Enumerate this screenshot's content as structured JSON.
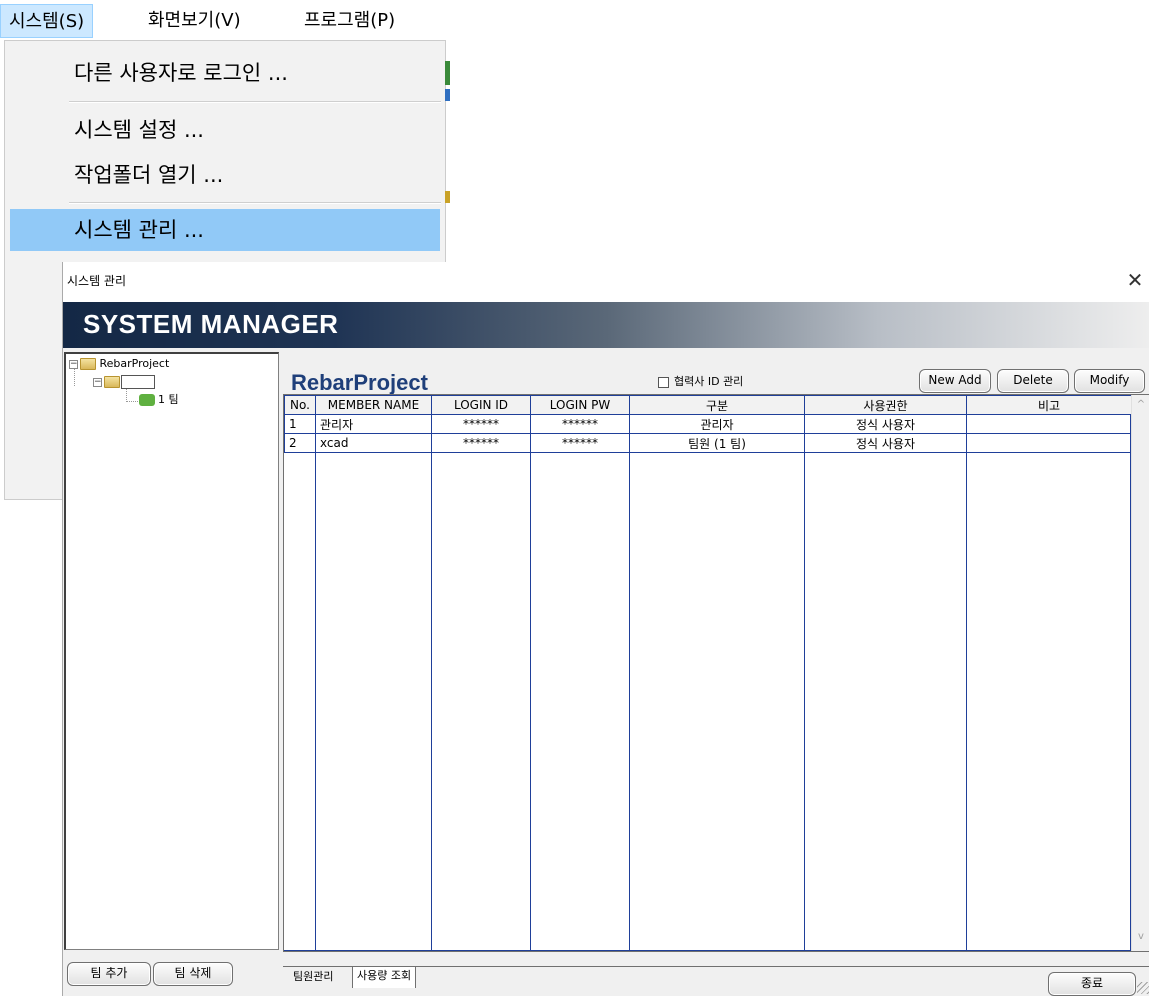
{
  "menubar": {
    "items": [
      {
        "label": "시스템(S)"
      },
      {
        "label": "화면보기(V)"
      },
      {
        "label": "프로그램(P)"
      }
    ]
  },
  "dropdown": {
    "items": [
      {
        "label": "다른 사용자로 로그인 ..."
      },
      {
        "label": "시스템 설정 ..."
      },
      {
        "label": "작업폴더 열기 ..."
      },
      {
        "label": "시스템 관리 ..."
      }
    ]
  },
  "dialog": {
    "title": "시스템 관리",
    "close_glyph": "✕",
    "banner": "SYSTEM MANAGER",
    "tree": {
      "root": "RebarProject",
      "team": "1 팀",
      "collapse_glyph": "−"
    },
    "left_buttons": {
      "add_team": "팀 추가",
      "delete_team": "팀 삭제"
    },
    "project_title": "RebarProject",
    "partner_checkbox": {
      "label": "협력사 ID 관리",
      "checked": false
    },
    "actions": {
      "new_add": "New Add",
      "delete": "Delete",
      "modify": "Modify"
    },
    "table": {
      "columns": [
        "No.",
        "MEMBER NAME",
        "LOGIN ID",
        "LOGIN PW",
        "구분",
        "사용권한",
        "비고"
      ],
      "rows": [
        [
          "1",
          "관리자",
          "******",
          "******",
          "관리자",
          "정식 사용자",
          ""
        ],
        [
          "2",
          "xcad",
          "******",
          "******",
          "팀원 (1 팀)",
          "정식 사용자",
          ""
        ]
      ]
    },
    "scroll": {
      "up": "^",
      "down": "v"
    },
    "tabs": {
      "members": "팀원관리",
      "usage": "사용량 조회"
    },
    "exit_button": "종료"
  },
  "colors": {
    "menu_highlight": "#91c9f7",
    "banner_dark": "#142845",
    "grid_line": "#1f3f99",
    "project_title": "#1f3f7a"
  }
}
